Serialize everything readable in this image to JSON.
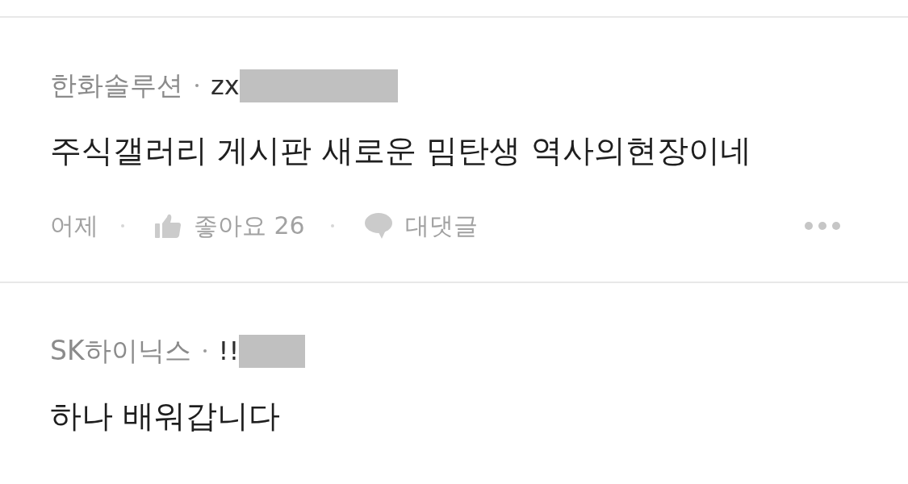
{
  "comments": [
    {
      "author": {
        "name": "한화솔루션",
        "handle": "zx",
        "redacted": true
      },
      "text": "주식갤러리 게시판 새로운 밈탄생 역사의현장이네",
      "footer": {
        "time": "어제",
        "like": "좋아요 26",
        "reply": "대댓글"
      }
    },
    {
      "author": {
        "name": "SK하이닉스",
        "handle": "!!",
        "redacted": true
      },
      "text": "하나 배워갑니다"
    }
  ]
}
